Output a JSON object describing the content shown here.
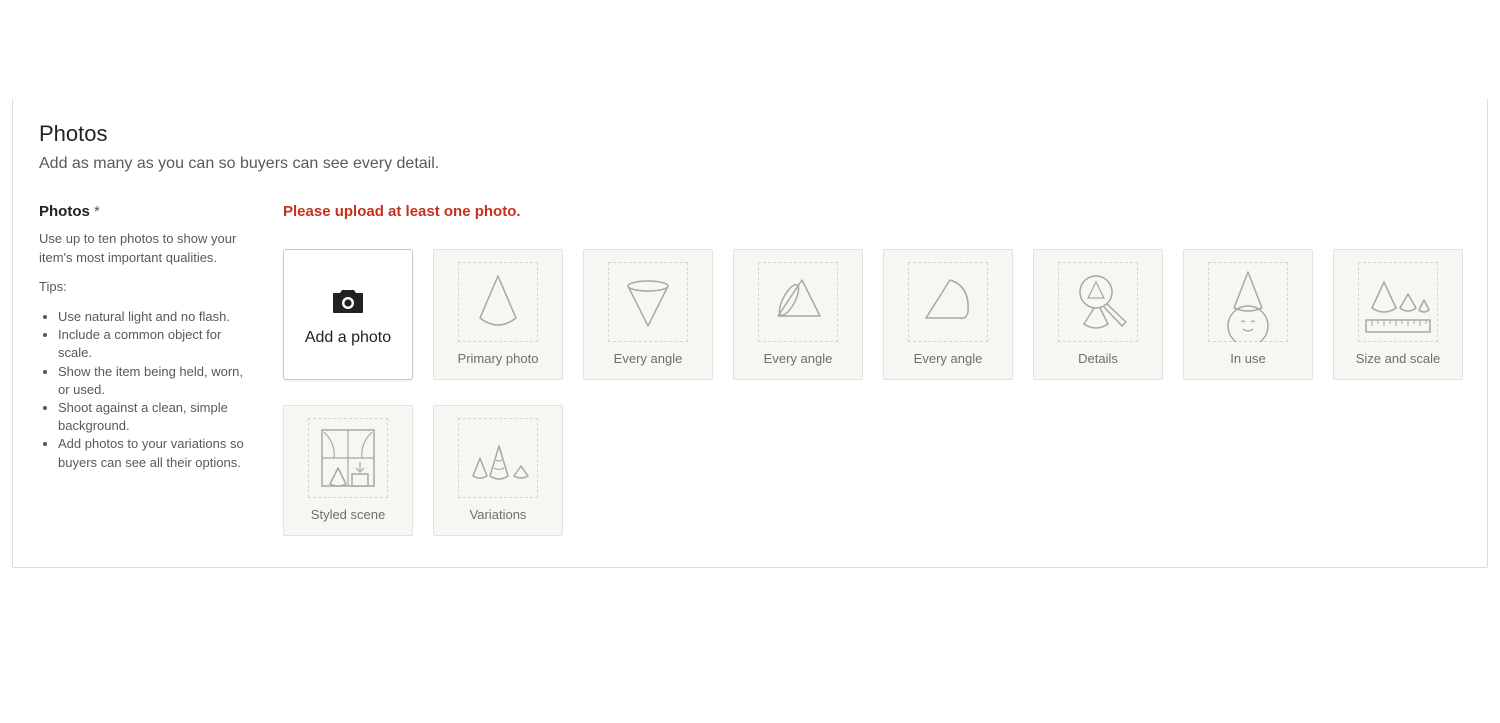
{
  "section": {
    "title": "Photos",
    "subtitle": "Add as many as you can so buyers can see every detail."
  },
  "sidebar": {
    "label": "Photos",
    "required_mark": "*",
    "description": "Use up to ten photos to show your item's most important qualities.",
    "tips_label": "Tips:",
    "tips": [
      "Use natural light and no flash.",
      "Include a common object for scale.",
      "Show the item being held, worn, or used.",
      "Shoot against a clean, simple background.",
      "Add photos to your variations so buyers can see all their options."
    ]
  },
  "error_message": "Please upload at least one photo.",
  "add_photo": {
    "label": "Add a photo",
    "icon": "camera-icon"
  },
  "slots": [
    {
      "caption": "Primary photo",
      "icon": "cone-icon"
    },
    {
      "caption": "Every angle",
      "icon": "cone-inverted-icon"
    },
    {
      "caption": "Every angle",
      "icon": "cone-tilted-icon"
    },
    {
      "caption": "Every angle",
      "icon": "cone-side-icon"
    },
    {
      "caption": "Details",
      "icon": "magnifier-icon"
    },
    {
      "caption": "In use",
      "icon": "cone-hat-face-icon"
    },
    {
      "caption": "Size and scale",
      "icon": "cones-ruler-icon"
    },
    {
      "caption": "Styled scene",
      "icon": "window-scene-icon"
    },
    {
      "caption": "Variations",
      "icon": "cone-variations-icon"
    }
  ],
  "colors": {
    "error": "#c4321e",
    "tile_bg": "#f7f6f3",
    "tile_border": "#e3e2dd",
    "dash": "#d6d4cd",
    "art_stroke": "#a9a7a0"
  }
}
